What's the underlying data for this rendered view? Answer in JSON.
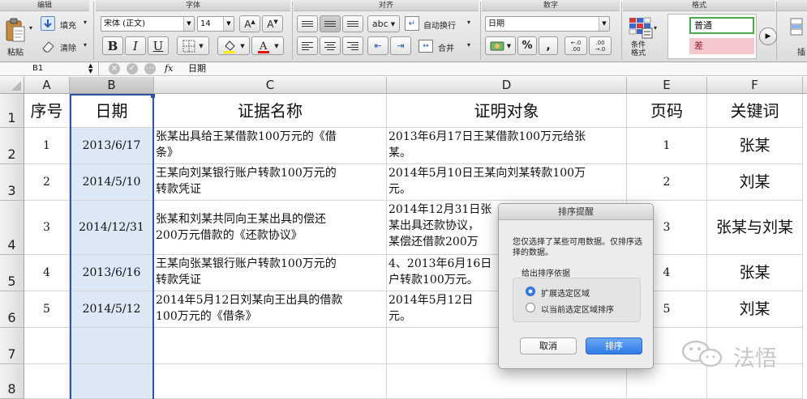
{
  "ribbon": {
    "groups": {
      "edit": "编辑",
      "font": "字体",
      "align": "对齐",
      "number": "数字",
      "format": "格式"
    },
    "paste_label": "粘贴",
    "fill_label": "填充",
    "clear_label": "清除",
    "font_name": "宋体 (正文)",
    "font_size": "14",
    "bold": "B",
    "italic": "I",
    "underline": "U",
    "abc_label": "abc",
    "wrap_label": "自动换行",
    "merge_label": "合并",
    "number_format": "日期",
    "percent": "%",
    "comma": ",",
    "dec_inc": "←.0\n.00",
    "dec_dec": ".00\n→.0",
    "cond_format_label": "条件\n格式",
    "style_normal": "普通",
    "style_bad": "差",
    "insert_label": "插"
  },
  "formula_bar": {
    "name_box": "B1",
    "fx_label": "fx",
    "value": "日期"
  },
  "sheet": {
    "columns": [
      "A",
      "B",
      "C",
      "D",
      "E",
      "F"
    ],
    "rows": [
      "1",
      "2",
      "3",
      "4",
      "5",
      "6",
      "7",
      "8"
    ],
    "header": [
      "序号",
      "日期",
      "证据名称",
      "证明对象",
      "页码",
      "关键词"
    ],
    "data": [
      {
        "no": "1",
        "date": "2013/6/17",
        "name": "张某出具给王某借款100万元的《借\n条》",
        "object": "2013年6月17日王某借款100万元给张\n某。",
        "page": "1",
        "kw": "张某"
      },
      {
        "no": "2",
        "date": "2014/5/10",
        "name": "王某向刘某银行账户转款100万元的\n转款凭证",
        "object": "2014年5月10日王某向刘某转款100万\n元。",
        "page": "2",
        "kw": "刘某"
      },
      {
        "no": "3",
        "date": "2014/12/31",
        "name": "张某和刘某共同向王某出具的偿还\n200万元借款的《还款协议》",
        "object": "2014年12月31日张\n某出具还款协议，\n某偿还借款200万",
        "page": "3",
        "kw": "张某与刘某"
      },
      {
        "no": "4",
        "date": "2013/6/16",
        "name": "王某向张某银行账户转款100万元的\n转款凭证",
        "object": "4、2013年6月16日\n户转款100万元。",
        "page": "4",
        "kw": "张某"
      },
      {
        "no": "5",
        "date": "2014/5/12",
        "name": "2014年5月12日刘某向王出具的借款\n100万元的《借条》",
        "object": "2014年5月12日\n元。",
        "page": "5",
        "kw": "刘某"
      }
    ]
  },
  "dialog": {
    "title": "排序提醒",
    "message": "您仅选择了某些可用数据。仅排序选择的数据。",
    "group_label": "给出排序依据",
    "option_expand": "扩展选定区域",
    "option_current": "以当前选定区域排序",
    "cancel_label": "取消",
    "sort_label": "排序"
  },
  "watermark": {
    "text": "法悟"
  },
  "colors": {
    "selection_border": "#2c55a3",
    "selection_fill": "#dde8f6",
    "primary_button": "#2f7be6"
  }
}
